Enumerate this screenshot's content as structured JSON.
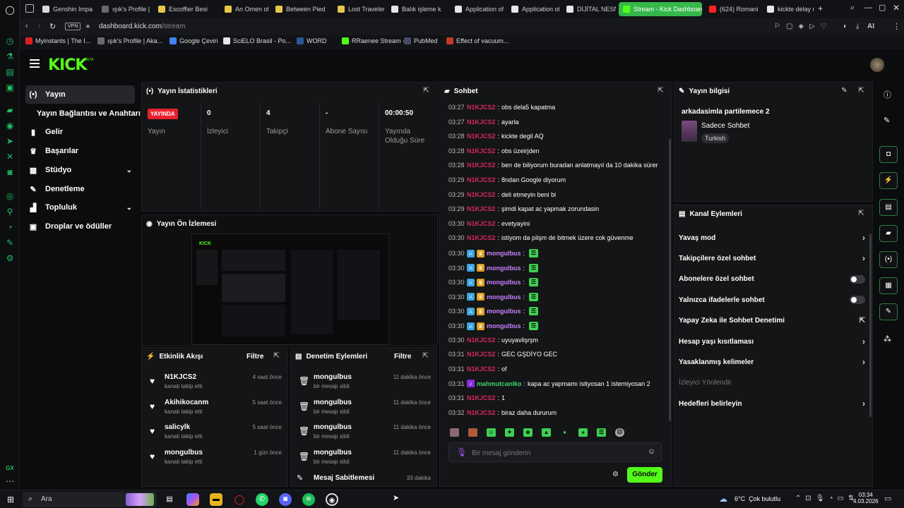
{
  "browser": {
    "tabs": [
      {
        "label": "Genshin Impa",
        "color": "#d9d9d9"
      },
      {
        "label": "ışık's Profile |",
        "color": "#6a6a6a"
      },
      {
        "label": "Escoffier Besi",
        "color": "#e5c84a"
      },
      {
        "label": "An Omen of A",
        "color": "#e5c84a"
      },
      {
        "label": "Between Pied",
        "color": "#e5c84a"
      },
      {
        "label": "Lost Traveler",
        "color": "#e5c84a"
      },
      {
        "label": "Balık işleme k",
        "color": "#e6e6e6"
      },
      {
        "label": "Application of",
        "color": "#e6e6e6"
      },
      {
        "label": "Application of",
        "color": "#e6e6e6"
      },
      {
        "label": "DİJİTAL NESN",
        "color": "#e6e6e6"
      },
      {
        "label": "Stream - Kick Dashboard",
        "color": "#53fc18"
      },
      {
        "label": "(624) Romani",
        "color": "#ff2020"
      },
      {
        "label": "kickte delay n",
        "color": "#e6e6e6"
      }
    ],
    "url_host": "dashboard.kick.com",
    "url_path": "/stream",
    "vpn": "VPN",
    "ai": "AI",
    "bookmarks": [
      {
        "label": "Myinstants | The I...",
        "color": "#e02020"
      },
      {
        "label": "ışık's Profile | Aka...",
        "color": "#6a6a6a"
      },
      {
        "label": "Google Çeviri",
        "color": "#4285f4"
      },
      {
        "label": "SciELO Brasil - Po...",
        "color": "#e6e6e6"
      },
      {
        "label": "WORD",
        "color": "#2b579a"
      },
      {
        "label": "RRaenee Stream -...",
        "color": "#53fc18"
      },
      {
        "label": "PubMed",
        "color": "#4a4a6a"
      },
      {
        "label": "Effect of vacuum...",
        "color": "#c0392b"
      }
    ]
  },
  "kick": {
    "logo": "KICK",
    "beta": "BETA"
  },
  "sidebar": {
    "items": [
      {
        "label": "Yayın",
        "icon": "broadcast-icon"
      },
      {
        "label": "Yayın Bağlantısı ve Anahtarı",
        "icon": ""
      },
      {
        "label": "Gelir",
        "icon": "chart-icon"
      },
      {
        "label": "Başarılar",
        "icon": "trophy-icon"
      },
      {
        "label": "Stüdyo",
        "icon": "studio-icon"
      },
      {
        "label": "Denetleme",
        "icon": "wrench-icon"
      },
      {
        "label": "Topluluk",
        "icon": "people-icon"
      },
      {
        "label": "Droplar ve ödüller",
        "icon": "gift-icon"
      }
    ]
  },
  "stats": {
    "title": "Yayın İstatistikleri",
    "live_badge": "YAYINDA",
    "live_label": "Yayın",
    "viewers_value": "0",
    "viewers_label": "İzleyici",
    "followers_value": "4",
    "followers_label": "Takipçi",
    "subs_value": "-",
    "subs_label": "Abone Sayısı",
    "uptime_value": "00:00:50",
    "uptime_label": "Yayında Olduğu Süre"
  },
  "preview": {
    "title": "Yayın Ön İzlemesi"
  },
  "activity": {
    "title": "Etkinlik Akışı",
    "filter": "Filtre",
    "rows": [
      {
        "name": "N1KJCS2",
        "sub": "kanalı takip etti",
        "time": "4 saat önce"
      },
      {
        "name": "Akihikocanm",
        "sub": "kanalı takip etti",
        "time": "5 saat önce"
      },
      {
        "name": "salicylk",
        "sub": "kanalı takip etti",
        "time": "5 saat önce"
      },
      {
        "name": "mongulbus",
        "sub": "kanalı takip etti",
        "time": "1 gün önce"
      }
    ]
  },
  "moderation": {
    "title": "Denetim Eylemleri",
    "filter": "Filtre",
    "rows": [
      {
        "name": "mongulbus",
        "sub": "bir mesajı sildi",
        "time": "11 dakika önce"
      },
      {
        "name": "mongulbus",
        "sub": "bir mesajı sildi",
        "time": "11 dakika önce"
      },
      {
        "name": "mongulbus",
        "sub": "bir mesajı sildi",
        "time": "11 dakika önce"
      },
      {
        "name": "mongulbus",
        "sub": "bir mesajı sildi",
        "time": "11 dakika önce"
      }
    ],
    "pinned_label": "Mesaj Sabitlemesi",
    "pinned_time": "33 dakika"
  },
  "chat": {
    "title": "Sohbet",
    "messages": [
      {
        "time": "03:27",
        "user": "N1KJCS2",
        "text": "obs dela5 kapatma",
        "kind": "u1"
      },
      {
        "time": "03:27",
        "user": "N1KJCS2",
        "text": "ayarla",
        "kind": "u1"
      },
      {
        "time": "03:28",
        "user": "N1KJCS2",
        "text": "kickte degil AQ",
        "kind": "u1"
      },
      {
        "time": "03:28",
        "user": "N1KJCS2",
        "text": "obs üzeirjden",
        "kind": "u1"
      },
      {
        "time": "03:28",
        "user": "N1KJCS2",
        "text": "ben de biliyorum buradan anlatmayıl da 10 dakika sürer",
        "kind": "u1"
      },
      {
        "time": "03:29",
        "user": "N1KJCS2",
        "text": "8ndan Google diyorum",
        "kind": "u1"
      },
      {
        "time": "03:29",
        "user": "N1KJCS2",
        "text": "deli etmeyin beni bi",
        "kind": "u1"
      },
      {
        "time": "03:29",
        "user": "N1KJCS2",
        "text": "şimdi kapat ac yapmak zorundasin",
        "kind": "u1"
      },
      {
        "time": "03:30",
        "user": "N1KJCS2",
        "text": "evetyayini",
        "kind": "u1"
      },
      {
        "time": "03:30",
        "user": "N1KJCS2",
        "text": "istiyom da pilşm de bitmek üzere cok güvenme",
        "kind": "u1"
      },
      {
        "time": "03:30",
        "user": "mongulbus",
        "text": "",
        "kind": "u2"
      },
      {
        "time": "03:30",
        "user": "mongulbus",
        "text": "",
        "kind": "u2"
      },
      {
        "time": "03:30",
        "user": "mongulbus",
        "text": "",
        "kind": "u2"
      },
      {
        "time": "03:30",
        "user": "mongulbus",
        "text": "",
        "kind": "u2"
      },
      {
        "time": "03:30",
        "user": "mongulbus",
        "text": "",
        "kind": "u2"
      },
      {
        "time": "03:30",
        "user": "mongulbus",
        "text": "",
        "kind": "u2"
      },
      {
        "time": "03:30",
        "user": "N1KJCS2",
        "text": "uyuyavlişrşm",
        "kind": "u1"
      },
      {
        "time": "03:31",
        "user": "N1KJCS2",
        "text": "GEC GŞDİYO GEC",
        "kind": "u1"
      },
      {
        "time": "03:31",
        "user": "N1KJCS2",
        "text": "of",
        "kind": "u1"
      },
      {
        "time": "03:31",
        "user": "mahmutcaniko",
        "text": "kapa ac yapmamı istiyosan 1 istemiyosan 2",
        "kind": "u3"
      },
      {
        "time": "03:31",
        "user": "N1KJCS2",
        "text": "1",
        "kind": "u1"
      },
      {
        "time": "03:32",
        "user": "N1KJCS2",
        "text": "biraz daha dururum",
        "kind": "u1"
      }
    ],
    "input_placeholder": "Bir mesaj gönderin",
    "send_label": "Gönder"
  },
  "stream_info": {
    "title": "Yayın bilgisi",
    "stream_title": "arkadasimla partilemece 2",
    "category": "Sadece Sohbet",
    "tag": "Turkish"
  },
  "channel_actions": {
    "title": "Kanal Eylemleri",
    "items": [
      {
        "label": "Yavaş mod",
        "control": "arrow"
      },
      {
        "label": "Takipçilere özel sohbet",
        "control": "arrow"
      },
      {
        "label": "Abonelere özel sohbet",
        "control": "toggle"
      },
      {
        "label": "Yalnızca ifadelerle sohbet",
        "control": "toggle"
      },
      {
        "label": "Yapay Zeka ile Sohbet Denetimi",
        "control": "external"
      },
      {
        "label": "Hesap yaşı kısıtlaması",
        "control": "arrow"
      },
      {
        "label": "Yasaklanmış kelimeler",
        "control": "arrow"
      },
      {
        "label": "İzleyici Yönlendir",
        "control": "none"
      },
      {
        "label": "Hedefleri belirleyin",
        "control": "arrow"
      }
    ]
  },
  "taskbar": {
    "search_placeholder": "Ara",
    "weather": "6°C  Çok bulutlu",
    "time": "03:34",
    "date": "4.03.2026",
    "gx": "GX"
  }
}
